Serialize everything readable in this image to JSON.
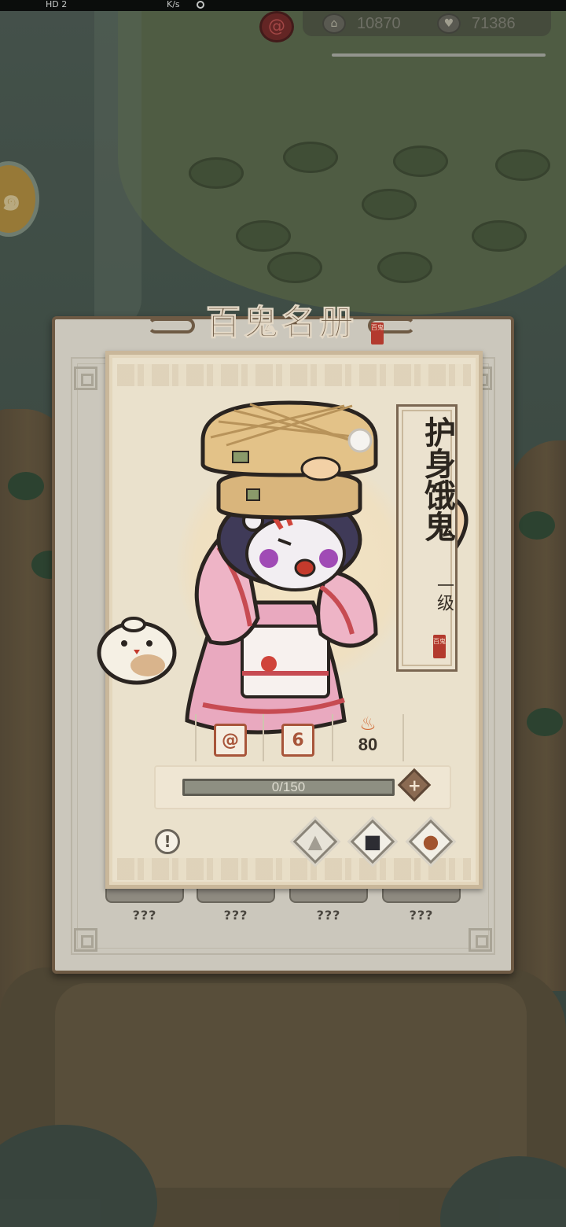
{
  "status_bar": {
    "left_text": "HD 2",
    "speed_text": "K/s"
  },
  "resources": {
    "special_icon": "red-swirl-icon",
    "currency_1": {
      "icon": "temple-icon",
      "value": "10870"
    },
    "currency_2": {
      "icon": "heart-icon",
      "value": "71386"
    }
  },
  "side_button": {
    "icon": "gold-coin-swirl-icon"
  },
  "register": {
    "title": "百鬼名册",
    "title_seal": "百鬼",
    "locked_slots": [
      "???",
      "???",
      "???",
      "???"
    ]
  },
  "ghost_card": {
    "name": "护身饿鬼",
    "level": "一级",
    "seal": "百鬼",
    "stats": {
      "element_icon": "swirl-tile-icon",
      "rank_value": "6",
      "power_icon": "flame-icon",
      "power_value": "80"
    },
    "exp": {
      "current": 0,
      "max": 150,
      "label": "0/150"
    },
    "actions": {
      "info": "!",
      "outfit_icon": "robe-icon",
      "book_icon": "book-icon",
      "bag_icon": "money-bag-icon"
    }
  },
  "colors": {
    "frame_brown": "#6e5a44",
    "card_paper": "#eae1cc",
    "accent_red": "#b33a2e",
    "flame_orange": "#d26a36"
  }
}
